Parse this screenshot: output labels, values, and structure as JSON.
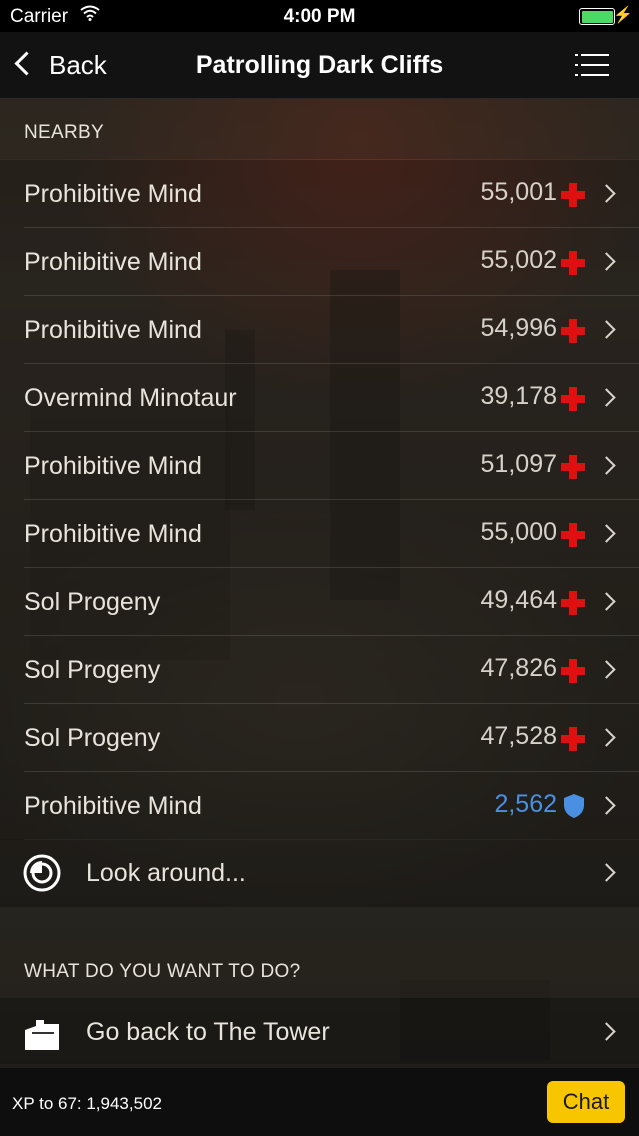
{
  "status_bar": {
    "carrier": "Carrier",
    "time": "4:00 PM"
  },
  "nav": {
    "back_label": "Back",
    "title": "Patrolling Dark Cliffs"
  },
  "nearby": {
    "header": "NEARBY",
    "items": [
      {
        "name": "Prohibitive Mind",
        "value": "55,001",
        "icon": "red-cross-icon"
      },
      {
        "name": "Prohibitive Mind",
        "value": "55,002",
        "icon": "red-cross-icon"
      },
      {
        "name": "Prohibitive Mind",
        "value": "54,996",
        "icon": "red-cross-icon"
      },
      {
        "name": "Overmind Minotaur",
        "value": "39,178",
        "icon": "red-cross-icon"
      },
      {
        "name": "Prohibitive Mind",
        "value": "51,097",
        "icon": "red-cross-icon"
      },
      {
        "name": "Prohibitive Mind",
        "value": "55,000",
        "icon": "red-cross-icon"
      },
      {
        "name": "Sol Progeny",
        "value": "49,464",
        "icon": "red-cross-icon"
      },
      {
        "name": "Sol Progeny",
        "value": "47,826",
        "icon": "red-cross-icon"
      },
      {
        "name": "Sol Progeny",
        "value": "47,528",
        "icon": "red-cross-icon"
      },
      {
        "name": "Prohibitive Mind",
        "value": "2,562",
        "icon": "blue-shield-icon"
      }
    ],
    "look_around": "Look around..."
  },
  "actions": {
    "header": "WHAT DO YOU WANT TO DO?",
    "go_back": "Go back to The Tower"
  },
  "footer": {
    "xp_text": "XP to 67: 1,943,502",
    "chat_label": "Chat"
  },
  "colors": {
    "accent_yellow": "#f7c600",
    "cross_red": "#e01010",
    "shield_blue": "#4a90e2",
    "battery_green": "#4cd964"
  }
}
